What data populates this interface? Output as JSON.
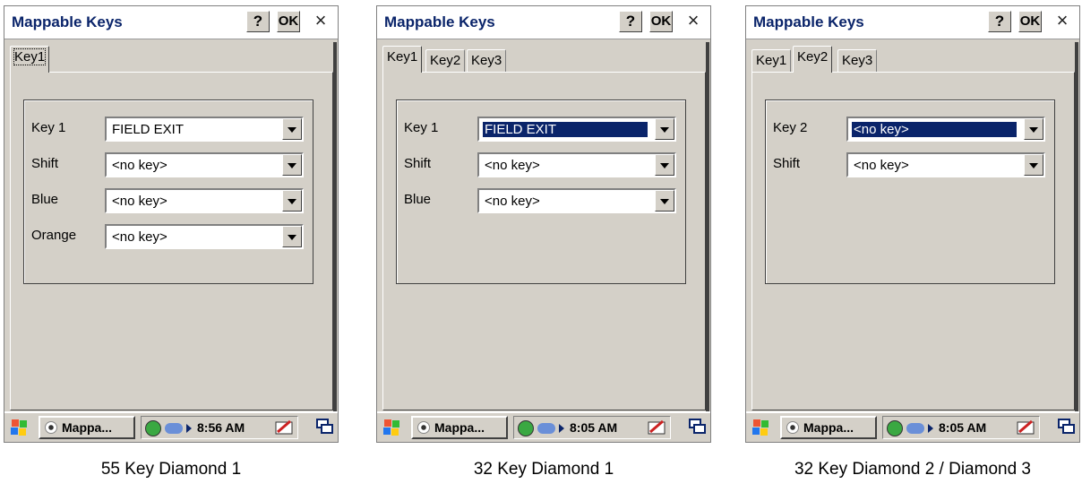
{
  "panels": [
    {
      "title": "Mappable Keys",
      "help_label": "?",
      "ok_label": "OK",
      "close_label": "×",
      "tabs": [
        "Key1"
      ],
      "rows": [
        {
          "label": "Key 1",
          "value": "FIELD EXIT"
        },
        {
          "label": "Shift",
          "value": "<no key>"
        },
        {
          "label": "Blue",
          "value": "<no key>"
        },
        {
          "label": "Orange",
          "value": "<no key>"
        }
      ],
      "taskbar_app": "Mappa...",
      "time": "8:56 AM",
      "caption": "55 Key Diamond 1"
    },
    {
      "title": "Mappable Keys",
      "help_label": "?",
      "ok_label": "OK",
      "close_label": "×",
      "tabs": [
        "Key1",
        "Key2",
        "Key3"
      ],
      "rows": [
        {
          "label": "Key 1",
          "value": "FIELD EXIT"
        },
        {
          "label": "Shift",
          "value": "<no key>"
        },
        {
          "label": "Blue",
          "value": "<no key>"
        }
      ],
      "taskbar_app": "Mappa...",
      "time": "8:05 AM",
      "caption": "32 Key Diamond 1"
    },
    {
      "title": "Mappable Keys",
      "help_label": "?",
      "ok_label": "OK",
      "close_label": "×",
      "tabs": [
        "Key1",
        "Key2",
        "Key3"
      ],
      "rows": [
        {
          "label": "Key 2",
          "value": "<no key>"
        },
        {
          "label": "Shift",
          "value": "<no key>"
        }
      ],
      "taskbar_app": "Mappa...",
      "time": "8:05 AM",
      "caption": "32 Key Diamond 2 / Diamond 3"
    }
  ]
}
